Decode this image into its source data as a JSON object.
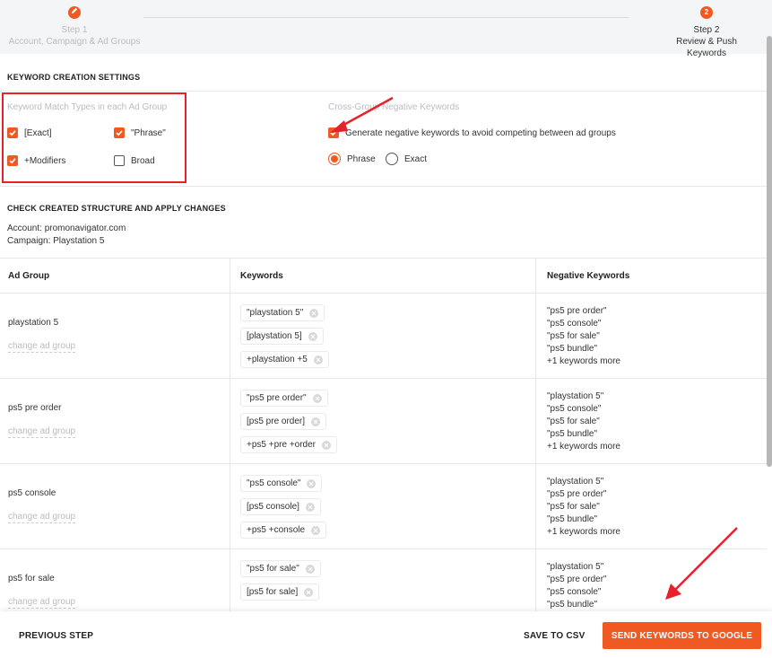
{
  "stepper": {
    "step1": {
      "label": "Step 1",
      "desc": "Account, Campaign & Ad Groups"
    },
    "step2": {
      "number": "2",
      "label": "Step 2",
      "desc": "Review & Push Keywords"
    }
  },
  "settings": {
    "title": "KEYWORD CREATION SETTINGS",
    "match_types": {
      "label": "Keyword Match Types in each Ad Group",
      "exact": "[Exact]",
      "phrase": "\"Phrase\"",
      "modifiers": "+Modifiers",
      "broad": "Broad"
    },
    "negative": {
      "label": "Cross-Group Negative Keywords",
      "generate": "Generate negative keywords to avoid competing between ad groups",
      "phrase": "Phrase",
      "exact": "Exact"
    }
  },
  "structure": {
    "title": "CHECK CREATED STRUCTURE AND APPLY CHANGES",
    "account": "Account: promonavigator.com",
    "campaign": "Campaign: Playstation 5"
  },
  "table": {
    "headers": {
      "ad_group": "Ad Group",
      "keywords": "Keywords",
      "negative": "Negative Keywords"
    },
    "change_label": "change ad group",
    "rows": [
      {
        "name": "playstation 5",
        "keywords": [
          "\"playstation 5\"",
          "[playstation 5]",
          "+playstation +5"
        ],
        "negatives": [
          "\"ps5 pre order\"",
          "\"ps5 console\"",
          "\"ps5 for sale\"",
          "\"ps5 bundle\"",
          "+1 keywords more"
        ]
      },
      {
        "name": "ps5 pre order",
        "keywords": [
          "\"ps5 pre order\"",
          "[ps5 pre order]",
          "+ps5 +pre +order"
        ],
        "negatives": [
          "\"playstation 5\"",
          "\"ps5 console\"",
          "\"ps5 for sale\"",
          "\"ps5 bundle\"",
          "+1 keywords more"
        ]
      },
      {
        "name": "ps5 console",
        "keywords": [
          "\"ps5 console\"",
          "[ps5 console]",
          "+ps5 +console"
        ],
        "negatives": [
          "\"playstation 5\"",
          "\"ps5 pre order\"",
          "\"ps5 for sale\"",
          "\"ps5 bundle\"",
          "+1 keywords more"
        ]
      },
      {
        "name": "ps5 for sale",
        "keywords": [
          "\"ps5 for sale\"",
          "[ps5 for sale]"
        ],
        "negatives": [
          "\"playstation 5\"",
          "\"ps5 pre order\"",
          "\"ps5 console\"",
          "\"ps5 bundle\""
        ]
      }
    ]
  },
  "footer": {
    "previous": "PREVIOUS STEP",
    "save_csv": "SAVE TO CSV",
    "send": "SEND KEYWORDS TO GOOGLE"
  },
  "colors": {
    "accent": "#f05a22",
    "highlight": "#e8202a"
  },
  "icons": [
    "pencil-icon",
    "check-icon",
    "remove-chip-icon",
    "red-arrow-annotation"
  ]
}
